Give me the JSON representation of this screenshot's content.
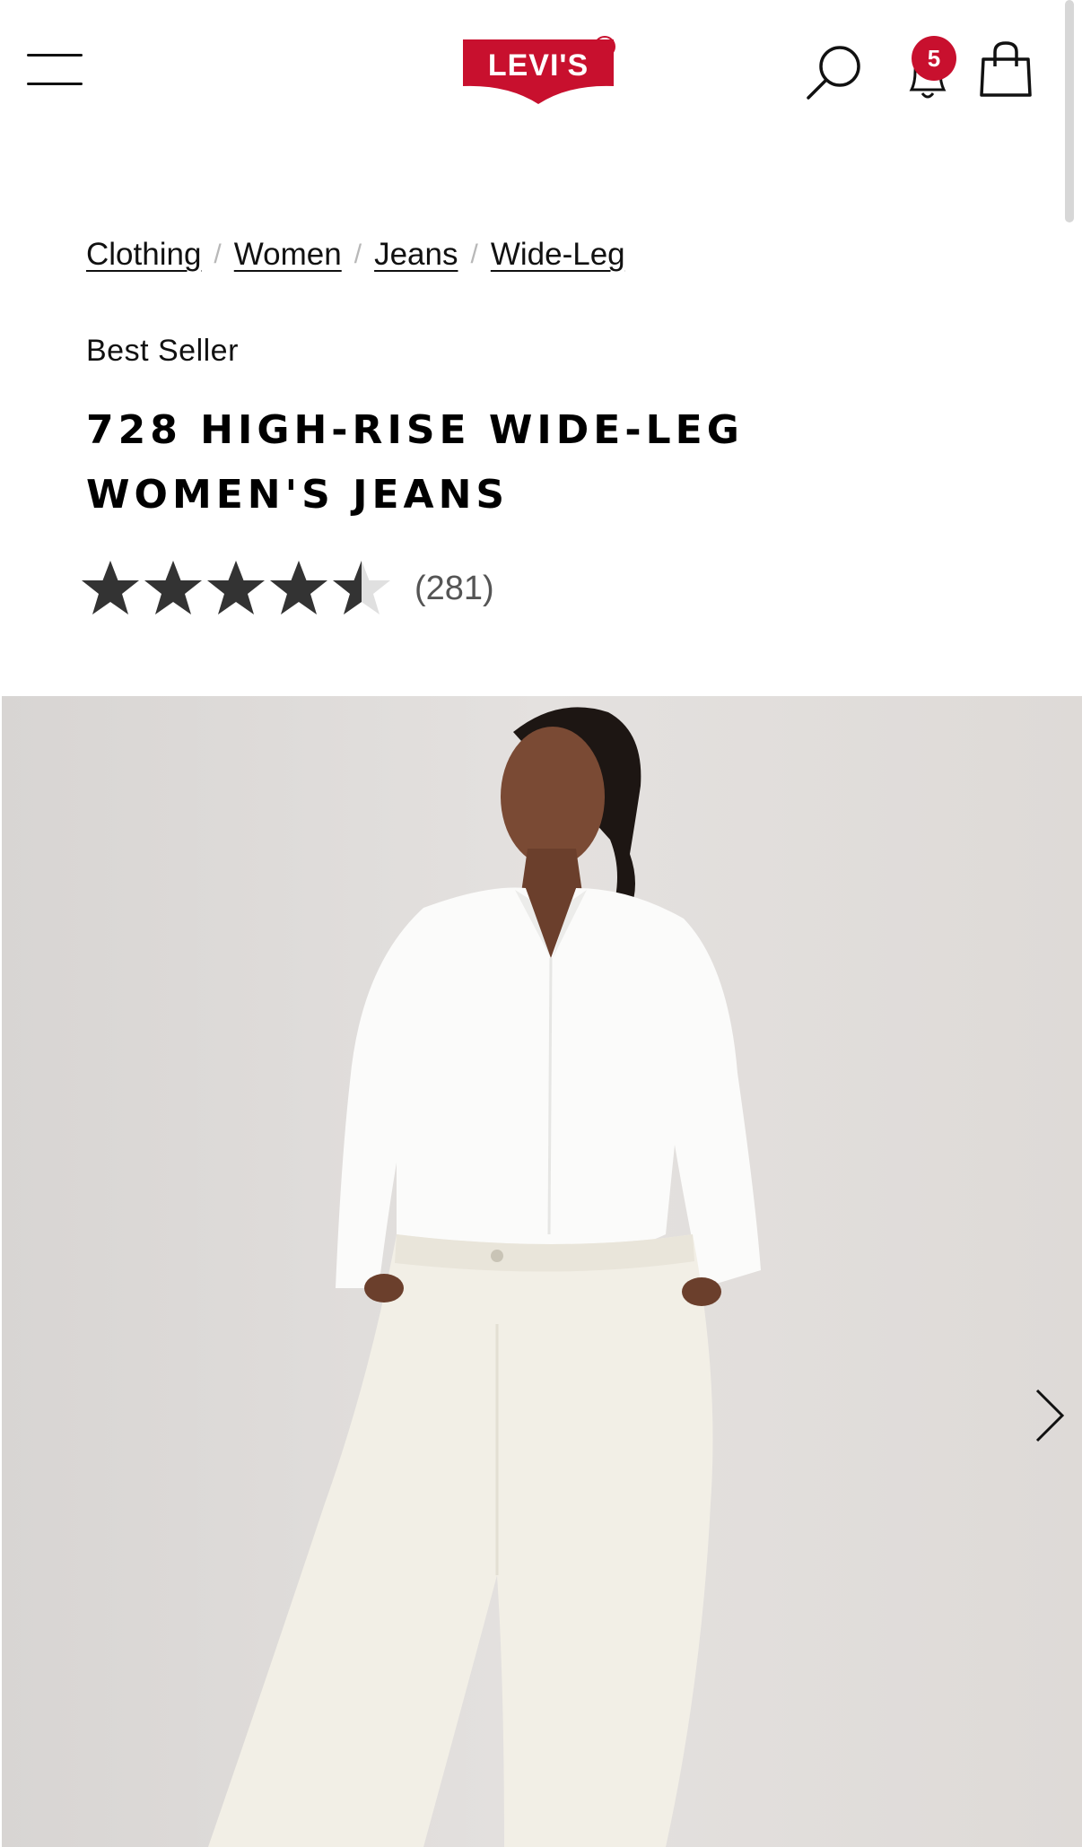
{
  "header": {
    "logo_text": "LEVI'S",
    "notification_count": "5",
    "icons": [
      "hamburger-menu-icon",
      "search-icon",
      "bell-icon",
      "shopping-bag-icon",
      "chevron-right-icon"
    ],
    "brand_color": "#c8102e"
  },
  "breadcrumb": {
    "items": [
      {
        "label": "Clothing"
      },
      {
        "label": "Women"
      },
      {
        "label": "Jeans"
      },
      {
        "label": "Wide-Leg"
      }
    ],
    "separator": "/"
  },
  "product": {
    "badge": "Best Seller",
    "title": "728 HIGH-RISE WIDE-LEG WOMEN'S JEANS",
    "rating": 4.5,
    "review_count": "(281)"
  },
  "colors": {
    "star_filled": "#333333",
    "star_empty": "#e0e0e0",
    "hero_background": "#e0dddb"
  }
}
